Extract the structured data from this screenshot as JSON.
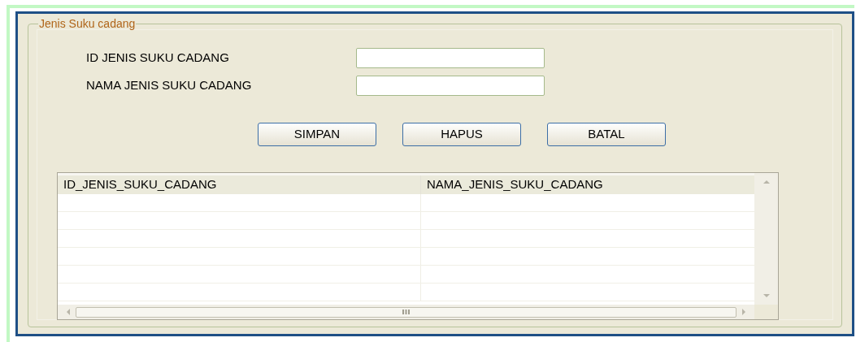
{
  "group_title": "Jenis Suku cadang",
  "fields": [
    {
      "label": "ID JENIS SUKU CADANG"
    },
    {
      "label": "NAMA JENIS SUKU CADANG"
    }
  ],
  "buttons": [
    "SIMPAN",
    "HAPUS",
    "BATAL"
  ],
  "table": {
    "columns": [
      "ID_JENIS_SUKU_CADANG",
      "NAMA_JENIS_SUKU_CADANG"
    ]
  }
}
